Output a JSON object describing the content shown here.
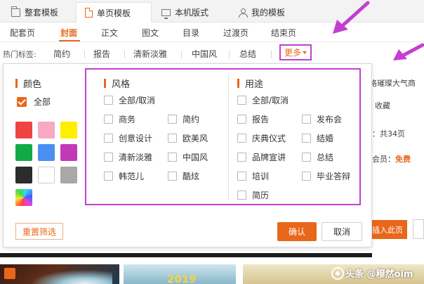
{
  "tabs": [
    {
      "label": "整套模板",
      "icon": "folder-icon",
      "active": false
    },
    {
      "label": "单页模板",
      "icon": "file-icon",
      "active": true
    },
    {
      "label": "本机版式",
      "icon": "monitor-icon",
      "active": false
    },
    {
      "label": "我的模板",
      "icon": "user-icon",
      "active": false
    }
  ],
  "categories": [
    "配套页",
    "封面",
    "正文",
    "图文",
    "目录",
    "过渡页",
    "结束页"
  ],
  "active_category": "封面",
  "hot_tags": {
    "label": "热门标签:",
    "items": [
      "简约",
      "报告",
      "清新淡雅",
      "中国风",
      "总结"
    ],
    "more": "更多"
  },
  "filter_panel": {
    "color": {
      "title": "颜色",
      "all_label": "全部",
      "all_checked": true,
      "swatches": [
        "#ee4444",
        "#f7a8c4",
        "#ffee00",
        "#11aa44",
        "#4c8ff0",
        "#c03ab8",
        "#2c2c2c",
        "#ffffff",
        "#a8a8a8",
        "multicolor"
      ]
    },
    "style": {
      "title": "风格",
      "toggle_all": "全部/取消",
      "options": [
        "商务",
        "简约",
        "创意设计",
        "欧美风",
        "清新淡雅",
        "中国风",
        "韩范儿",
        "酷炫"
      ]
    },
    "usage": {
      "title": "用途",
      "toggle_all": "全部/取消",
      "options": [
        "报告",
        "发布会",
        "庆典仪式",
        "结婚",
        "品牌宣讲",
        "总结",
        "培训",
        "毕业答辩",
        "简历"
      ]
    },
    "reset_label": "重置筛选",
    "confirm_label": "确认",
    "cancel_label": "取消"
  },
  "background_panel": {
    "title_fragment": "格璀璨大气商",
    "favorite_label": "收藏",
    "pages_label": "：共34页",
    "member_label": "会员：",
    "member_value": "免费",
    "insert_label": "插入此页"
  },
  "thumbnails": {
    "year_fragment": "2019",
    "watermark": "头条 @穆然oim"
  },
  "colors": {
    "accent": "#e9671a",
    "annotation": "#c43fd0"
  }
}
